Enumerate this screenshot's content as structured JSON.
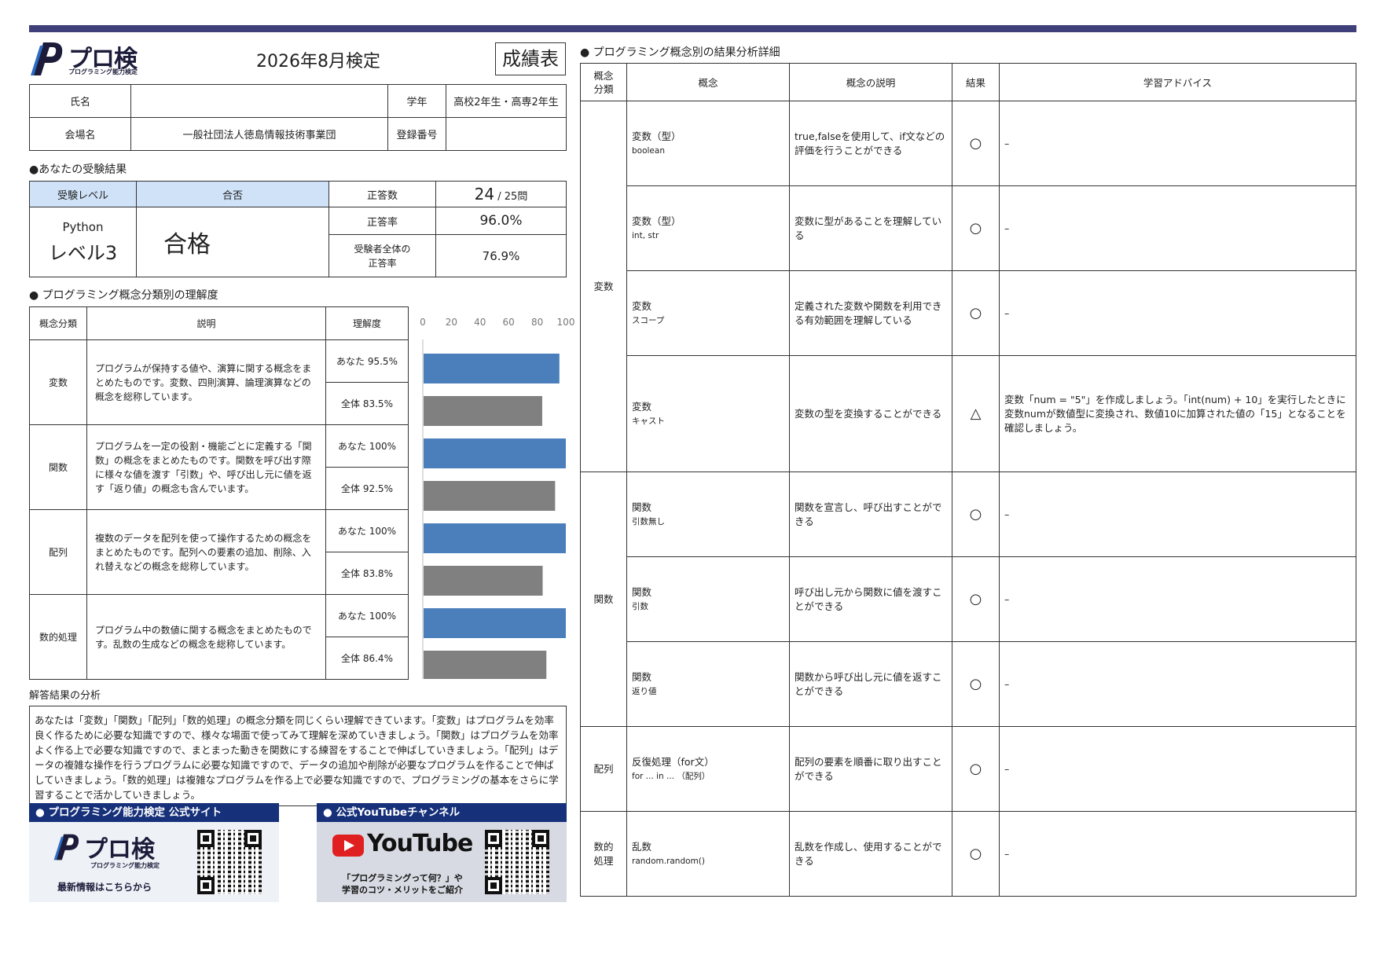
{
  "header": {
    "logo_text": "プロ検",
    "logo_sub": "プログラミング能力検定",
    "exam_title": "2026年8月検定",
    "report_label": "成績表"
  },
  "info": {
    "name_label": "氏名",
    "name_value": "",
    "grade_label": "学年",
    "grade_value": "高校2年生・高専2年生",
    "venue_label": "会場名",
    "venue_value": "一般社団法人徳島情報技術事業団",
    "reg_label": "登録番号",
    "reg_value": ""
  },
  "result": {
    "section_title": "●あなたの受験結果",
    "level_label": "受験レベル",
    "pass_label": "合否",
    "correct_count_label": "正答数",
    "correct_count": "24",
    "total_questions": "/ 25問",
    "language": "Python",
    "level": "レベル3",
    "pass_value": "合格",
    "correct_rate_label": "正答率",
    "correct_rate": "96.0%",
    "all_rate_label_1": "受験者全体の",
    "all_rate_label_2": "正答率",
    "all_rate": "76.9%"
  },
  "concepts": {
    "section_title": "● プログラミング概念分類別の理解度",
    "headers": {
      "category": "概念分類",
      "desc": "説明",
      "understanding": "理解度"
    },
    "rows": [
      {
        "category": "変数",
        "desc": "プログラムが保持する値や、演算に関する概念をまとめたものです。変数、四則演算、論理演算などの概念を総称しています。",
        "you": "あなた 95.5%",
        "all": "全体 83.5%"
      },
      {
        "category": "関数",
        "desc": "プログラムを一定の役割・機能ごとに定義する「関数」の概念をまとめたものです。関数を呼び出す際に様々な値を渡す「引数」や、呼び出し元に値を返す「返り値」の概念も含んでいます。",
        "you": "あなた 100%",
        "all": "全体 92.5%"
      },
      {
        "category": "配列",
        "desc": "複数のデータを配列を使って操作するための概念をまとめたものです。配列への要素の追加、削除、入れ替えなどの概念を総称しています。",
        "you": "あなた 100%",
        "all": "全体 83.8%"
      },
      {
        "category": "数的処理",
        "desc": "プログラム中の数値に関する概念をまとめたものです。乱数の生成などの概念を総称しています。",
        "you": "あなた 100%",
        "all": "全体 86.4%"
      }
    ]
  },
  "chart_data": {
    "type": "bar",
    "orientation": "horizontal",
    "categories": [
      "変数",
      "関数",
      "配列",
      "数的処理"
    ],
    "series": [
      {
        "name": "あなた",
        "values": [
          95.5,
          100,
          100,
          100
        ],
        "color": "#4a7fbc"
      },
      {
        "name": "全体",
        "values": [
          83.5,
          92.5,
          83.8,
          86.4
        ],
        "color": "#808080"
      }
    ],
    "xlim": [
      0,
      100
    ],
    "ticks": [
      "0",
      "20",
      "40",
      "60",
      "80",
      "100"
    ],
    "grid": false
  },
  "analysis": {
    "title": "解答結果の分析",
    "text": "あなたは「変数」「関数」「配列」「数的処理」の概念分類を同じくらい理解できています。「変数」はプログラムを効率良く作るために必要な知識ですので、様々な場面で使ってみて理解を深めていきましょう。「関数」はプログラムを効率よく作る上で必要な知識ですので、まとまった動きを関数にする練習をすることで伸ばしていきましょう。「配列」はデータの複雑な操作を行うプログラムに必要な知識ですので、データの追加や削除が必要なプログラムを作ることで伸ばしていきましょう。「数的処理」は複雑なプログラムを作る上で必要な知識ですので、プログラミングの基本をさらに学習することで活かしていきましょう。"
  },
  "banners": {
    "site_title": "● プログラミング能力検定 公式サイト",
    "site_logo": "プロ検",
    "site_logo_sub": "プログラミング能力検定",
    "site_caption": "最新情報はこちらから",
    "yt_title": "● 公式YouTubeチャンネル",
    "yt_logo": "YouTube",
    "yt_caption_1": "「プログラミングって何？」や",
    "yt_caption_2": "学習のコツ・メリットをご紹介"
  },
  "detail": {
    "section_title": "● プログラミング概念別の結果分析詳細",
    "headers": {
      "category_1": "概念",
      "category_2": "分類",
      "concept": "概念",
      "desc": "概念の説明",
      "result": "結果",
      "advice": "学習アドバイス"
    },
    "groups": [
      {
        "category": [
          "変数"
        ],
        "rows": [
          {
            "name": "変数（型）",
            "sub": "boolean",
            "desc": "true,falseを使用して、if文などの評価を行うことができる",
            "result": "○",
            "advice": "–"
          },
          {
            "name": "変数（型）",
            "sub": "int, str",
            "desc": "変数に型があることを理解している",
            "result": "○",
            "advice": "–"
          },
          {
            "name": "変数",
            "sub": "スコープ",
            "desc": "定義された変数や関数を利用できる有効範囲を理解している",
            "result": "○",
            "advice": "–"
          },
          {
            "name": "変数",
            "sub": "キャスト",
            "desc": "変数の型を変換することができる",
            "result": "△",
            "advice": "変数「num = \"5\"」を作成しましょう。「int(num) + 10」を実行したときに変数numが数値型に変換され、数値10に加算された値の「15」となることを確認しましょう。"
          }
        ]
      },
      {
        "category": [
          "関数"
        ],
        "rows": [
          {
            "name": "関数",
            "sub": "引数無し",
            "desc": "関数を宣言し、呼び出すことができる",
            "result": "○",
            "advice": "–"
          },
          {
            "name": "関数",
            "sub": "引数",
            "desc": "呼び出し元から関数に値を渡すことができる",
            "result": "○",
            "advice": "–"
          },
          {
            "name": "関数",
            "sub": "返り値",
            "desc": "関数から呼び出し元に値を返すことができる",
            "result": "○",
            "advice": "–"
          }
        ]
      },
      {
        "category": [
          "配列"
        ],
        "rows": [
          {
            "name": "反復処理（for文）",
            "sub": "for ... in ... （配列）",
            "desc": "配列の要素を順番に取り出すことができる",
            "result": "○",
            "advice": "–"
          }
        ]
      },
      {
        "category": [
          "数的",
          "処理"
        ],
        "rows": [
          {
            "name": "乱数",
            "sub": "random.random()",
            "desc": "乱数を作成し、使用することができる",
            "result": "○",
            "advice": "–"
          }
        ]
      }
    ]
  },
  "colors": {
    "bar_you": "#4a7fbc",
    "bar_all": "#808080",
    "header_blue": "#cfe2f8",
    "top_bar": "#3f3f7a",
    "banner_head": "#16307a"
  }
}
